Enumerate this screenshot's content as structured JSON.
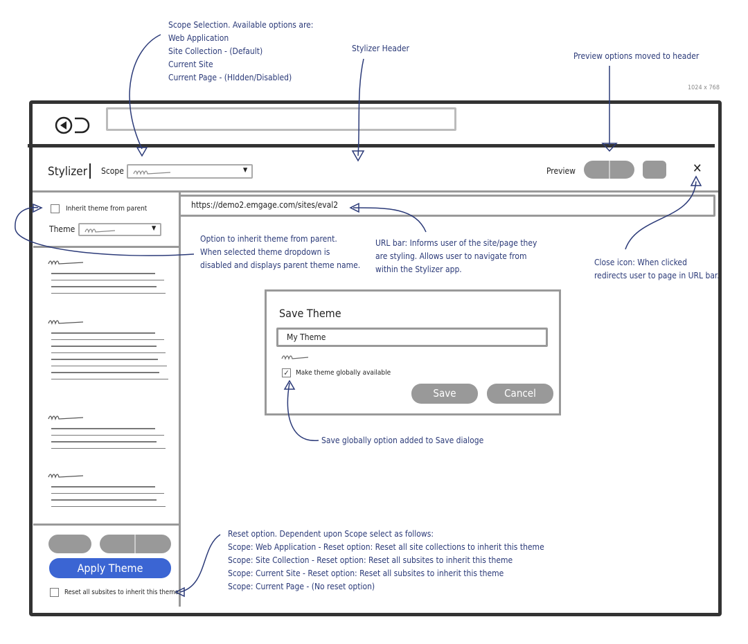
{
  "size_label": "1024 x 768",
  "annotations": {
    "scope": [
      "Scope Selection. Available options are:",
      "Web Application",
      "Site Collection - (Default)",
      "Current Site",
      "Current Page - (HIdden/Disabled)"
    ],
    "header": "Stylizer Header",
    "preview": "Preview options moved to header",
    "inherit": [
      "Option to inherit theme from parent.",
      "When selected theme dropdown is",
      "disabled and displays parent theme name."
    ],
    "url": [
      "URL bar: Informs user of the site/page they",
      "are styling. Allows user to navigate from",
      "within the Stylizer app."
    ],
    "close": [
      "Close icon: When clicked",
      "redirects user to page in URL bar."
    ],
    "save_global": "Save globally option added to Save dialoge",
    "reset": [
      "Reset option. Dependent upon Scope select as follows:",
      "Scope: Web Application - Reset option: Reset all site collections to inherit this theme",
      "Scope: Site Collection - Reset option: Reset all subsites to inherit this theme",
      "Scope: Current Site - Reset option: Reset all subsites to inherit this theme",
      "Scope: Current Page - (No reset option)"
    ]
  },
  "header": {
    "title": "Stylizer",
    "scope_label": "Scope",
    "preview_label": "Preview",
    "close_icon": "close-icon"
  },
  "url_bar": {
    "value": "https://demo2.emgage.com/sites/eval2"
  },
  "sidebar": {
    "inherit_label": "Inherit theme from parent",
    "inherit_checked": false,
    "theme_label": "Theme",
    "apply_label": "Apply Theme",
    "reset_label": "Reset all subsites to inherit this theme",
    "reset_checked": false
  },
  "dialog": {
    "title": "Save Theme",
    "name_value": "My Theme",
    "global_label": "Make theme globally available",
    "global_checked": true,
    "save_label": "Save",
    "cancel_label": "Cancel"
  },
  "colors": {
    "annotation": "#2b3a78",
    "accent": "#3b65d3",
    "wire": "#999999"
  }
}
